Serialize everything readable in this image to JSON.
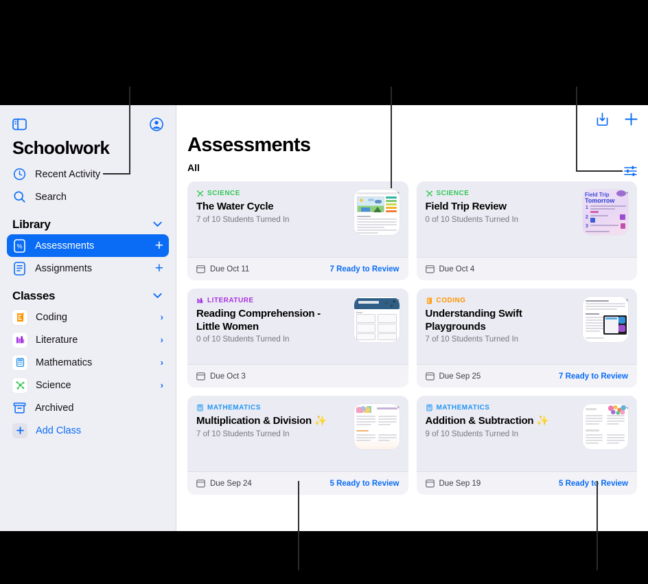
{
  "sidebar": {
    "app_title": "Schoolwork",
    "sidebar_toggle_icon": "sidebar-toggle-icon",
    "account_icon": "account-circle-icon",
    "top_items": [
      {
        "label": "Recent Activity",
        "icon": "clock-icon"
      },
      {
        "label": "Search",
        "icon": "search-icon"
      }
    ],
    "library": {
      "header": "Library",
      "items": [
        {
          "label": "Assessments",
          "icon": "assessment-icon",
          "selected": true,
          "action": "+"
        },
        {
          "label": "Assignments",
          "icon": "assignment-icon",
          "selected": false,
          "action": "+"
        }
      ]
    },
    "classes": {
      "header": "Classes",
      "items": [
        {
          "label": "Coding",
          "icon": "coding-icon",
          "chevron": "›"
        },
        {
          "label": "Literature",
          "icon": "literature-icon",
          "chevron": "›"
        },
        {
          "label": "Mathematics",
          "icon": "mathematics-icon",
          "chevron": "›"
        },
        {
          "label": "Science",
          "icon": "science-icon",
          "chevron": "›"
        }
      ],
      "archived": {
        "label": "Archived",
        "icon": "archive-box-icon"
      },
      "add_class": {
        "label": "Add Class",
        "icon": "plus-icon"
      }
    }
  },
  "main": {
    "title": "Assessments",
    "filter_label": "All",
    "toolbar": {
      "share_icon": "share-upload-icon",
      "add_icon": "plus-icon",
      "filter_icon": "sliders-filter-icon"
    },
    "cards": [
      {
        "category": "SCIENCE",
        "category_color": "#34c759",
        "category_icon": "science-icon",
        "title": "The Water Cycle",
        "subtitle": "7 of 10 Students Turned In",
        "due": "Due Oct 11",
        "ready": "7 Ready to Review",
        "favorited": false,
        "thumb": "water-cycle-worksheet"
      },
      {
        "category": "SCIENCE",
        "category_color": "#34c759",
        "category_icon": "science-icon",
        "title": "Field Trip Review",
        "subtitle": "0 of 10 Students Turned In",
        "due": "Due Oct 4",
        "ready": "",
        "favorited": false,
        "thumb": "field-trip-tomorrow"
      },
      {
        "category": "LITERATURE",
        "category_color": "#a832e0",
        "category_icon": "literature-icon",
        "title": "Reading Comprehension - Little Women",
        "subtitle": "0 of 10 Students Turned In",
        "due": "Due Oct 3",
        "ready": "",
        "favorited": false,
        "thumb": "little-women-worksheet"
      },
      {
        "category": "CODING",
        "category_color": "#ff9500",
        "category_icon": "coding-icon",
        "title": "Understanding Swift Playgrounds",
        "subtitle": "7 of 10 Students Turned In",
        "due": "Due Sep 25",
        "ready": "7 Ready to Review",
        "favorited": false,
        "thumb": "swift-playgrounds-doc"
      },
      {
        "category": "MATHEMATICS",
        "category_color": "#2196f3",
        "category_icon": "mathematics-icon",
        "title": "Multiplication & Division ✨",
        "subtitle": "7 of 10 Students Turned In",
        "due": "Due Sep 24",
        "ready": "5 Ready to Review",
        "favorited": false,
        "thumb": "multiplication-worksheet"
      },
      {
        "category": "MATHEMATICS",
        "category_color": "#2196f3",
        "category_icon": "mathematics-icon",
        "title": "Addition & Subtraction ✨",
        "subtitle": "9 of 10 Students Turned In",
        "due": "Due Sep 19",
        "ready": "5 Ready to Review",
        "favorited": true,
        "thumb": "addition-worksheet"
      }
    ]
  },
  "colors": {
    "accent": "#0a6cf5",
    "sidebar_bg": "#eeeef5",
    "card_bg": "#ebebf3",
    "card_footer_bg": "#f2f2f7"
  }
}
